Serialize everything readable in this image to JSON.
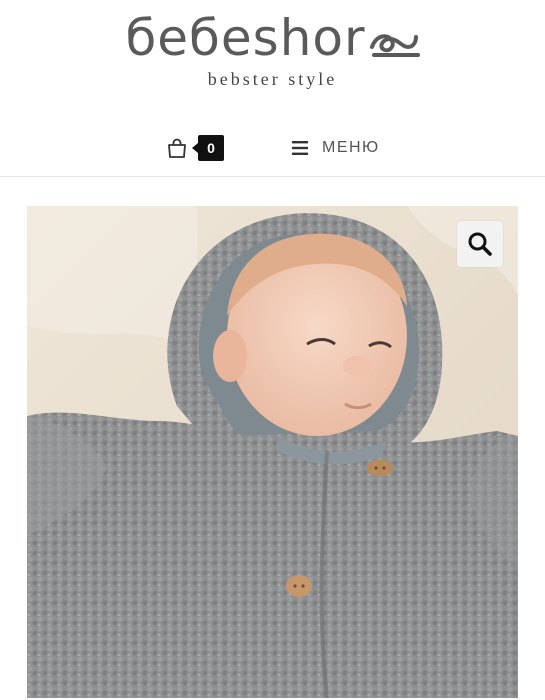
{
  "brand": {
    "name": "бебeshor",
    "tagline": "bebster style"
  },
  "nav": {
    "cart_count": "0",
    "menu_label": "МЕНЮ"
  },
  "product": {
    "image_subject": "baby-in-grey-sherpa-hooded-jacket"
  },
  "icons": {
    "cart": "shopping-bag-icon",
    "menu": "hamburger-icon",
    "zoom": "magnifier-icon"
  },
  "colors": {
    "logo": "#5a5a5a",
    "badge": "#111111",
    "divider": "#e6e6e6",
    "zoom_bg": "#f2f2f2"
  }
}
